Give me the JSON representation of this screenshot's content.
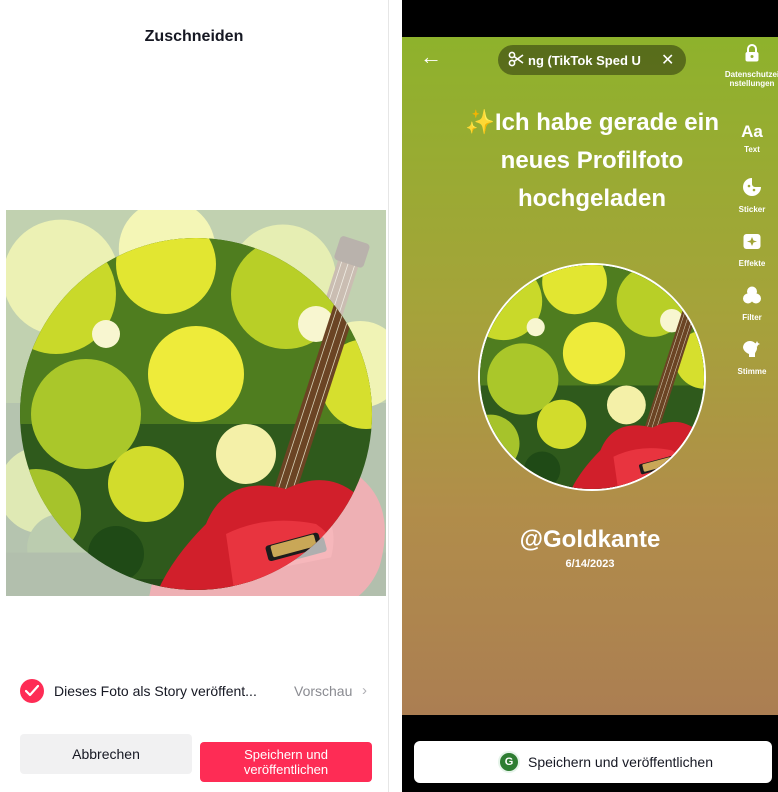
{
  "crop_screen": {
    "title": "Zuschneiden",
    "story_option_label": "Dieses Foto als Story veröffent...",
    "preview_label": "Vorschau",
    "cancel_label": "Abbrechen",
    "save_label": "Speichern und veröffentlichen",
    "story_checked": true
  },
  "story_screen": {
    "sound_name": "ng (TikTok Sped U",
    "headline": "✨Ich habe gerade ein neues Profilfoto hochgeladen",
    "username": "@Goldkante",
    "date": "6/14/2023",
    "tools": [
      {
        "label": "Datenschutzeinstellungen",
        "icon": "lock-icon"
      },
      {
        "label": "Text",
        "icon": "text-icon"
      },
      {
        "label": "Sticker",
        "icon": "sticker-icon"
      },
      {
        "label": "Effekte",
        "icon": "effects-icon"
      },
      {
        "label": "Filter",
        "icon": "filter-icon"
      },
      {
        "label": "Stimme",
        "icon": "voice-icon"
      }
    ],
    "text_tool_glyph": "Aa",
    "publish_label": "Speichern und veröffentlichen",
    "publish_avatar_letter": "G"
  },
  "colors": {
    "accent": "#fe2c55",
    "story_top": "#8eb22c",
    "story_bottom": "#ab7e52"
  }
}
